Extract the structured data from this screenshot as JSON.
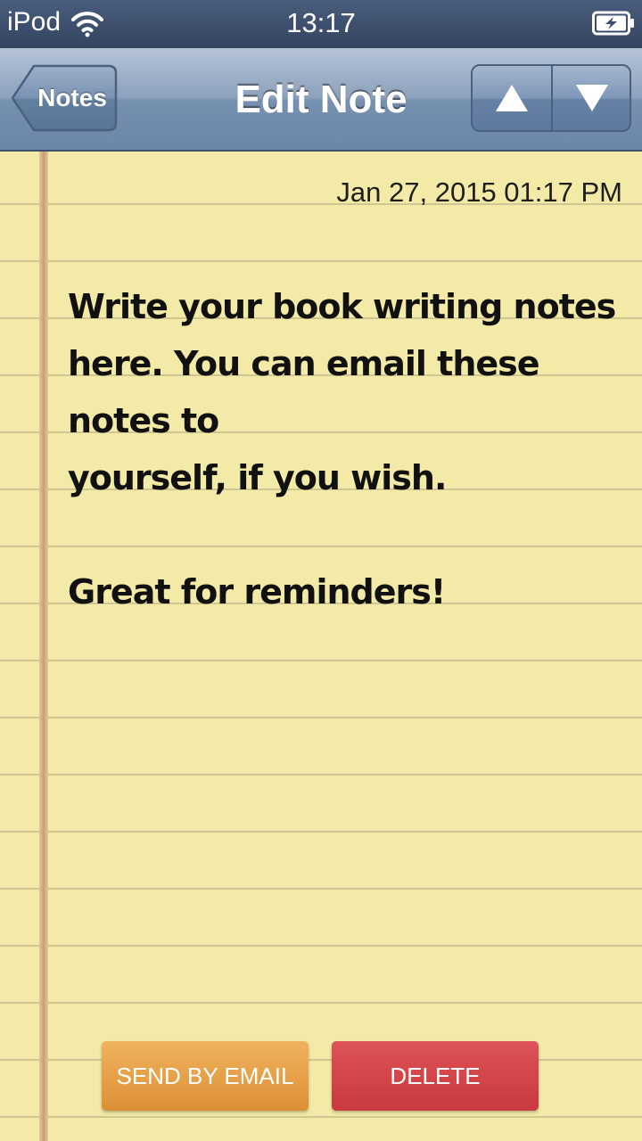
{
  "status_bar": {
    "carrier": "iPod",
    "time": "13:17",
    "wifi_icon": "wifi-icon",
    "battery_icon": "battery-charging-icon"
  },
  "nav": {
    "back_label": "Notes",
    "title": "Edit Note",
    "up_icon": "arrow-up-icon",
    "down_icon": "arrow-down-icon"
  },
  "note": {
    "date": "Jan 27, 2015 01:17 PM",
    "body": "Write your book writing notes\nhere. You can email these notes to\nyourself, if you wish.\n\nGreat for reminders!"
  },
  "actions": {
    "email_label": "SEND BY EMAIL",
    "delete_label": "DELETE"
  },
  "colors": {
    "paper": "#f2eaa6",
    "ruled_line": "#cfc793",
    "margin_line": "#c99f70",
    "nav_bar": "#7690b0",
    "email_button": "#e8a24a",
    "delete_button": "#d34448"
  }
}
